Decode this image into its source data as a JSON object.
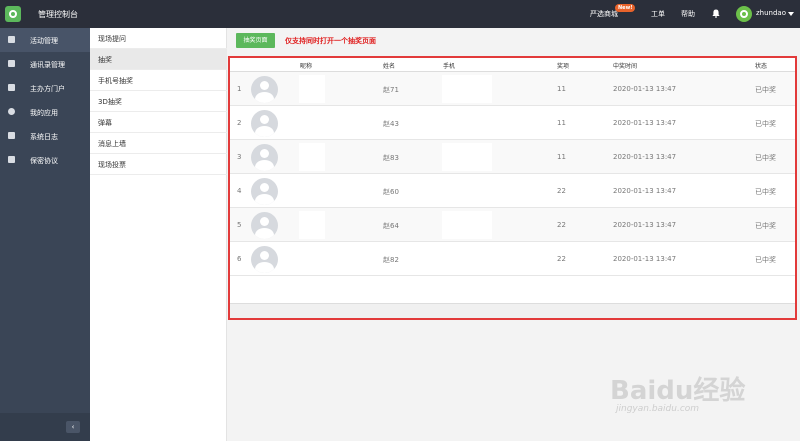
{
  "header": {
    "brand_title": "管理控制台",
    "nav_shop": "严选商城",
    "badge_new": "New!",
    "nav_ticket": "工单",
    "nav_help": "帮助",
    "username": "zhundao"
  },
  "sidebar": {
    "items": [
      {
        "label": "活动管理",
        "icon": "home-icon"
      },
      {
        "label": "通讯录管理",
        "icon": "contacts-icon"
      },
      {
        "label": "主办方门户",
        "icon": "portal-icon"
      },
      {
        "label": "我的应用",
        "icon": "app-icon"
      },
      {
        "label": "系统日志",
        "icon": "log-icon"
      },
      {
        "label": "保密协议",
        "icon": "document-icon"
      }
    ],
    "collapse_label": "‹"
  },
  "submenu": {
    "items": [
      {
        "label": "现场提问"
      },
      {
        "label": "抽奖"
      },
      {
        "label": "手机号抽奖"
      },
      {
        "label": "3D抽奖"
      },
      {
        "label": "弹幕"
      },
      {
        "label": "消息上墙"
      },
      {
        "label": "现场投票"
      }
    ]
  },
  "main": {
    "lottery_button": "抽奖页面",
    "tip": "仅支持同时打开一个抽奖页面",
    "table": {
      "headers": [
        "昵称",
        "姓名",
        "手机",
        "奖项",
        "中奖时间",
        "状态"
      ],
      "rows": [
        {
          "index": "1",
          "name": "赵71",
          "prize": "11",
          "time": "2020-01-13 13:47",
          "status": "已中奖"
        },
        {
          "index": "2",
          "name": "赵43",
          "prize": "11",
          "time": "2020-01-13 13:47",
          "status": "已中奖"
        },
        {
          "index": "3",
          "name": "赵83",
          "prize": "11",
          "time": "2020-01-13 13:47",
          "status": "已中奖"
        },
        {
          "index": "4",
          "name": "赵60",
          "prize": "22",
          "time": "2020-01-13 13:47",
          "status": "已中奖"
        },
        {
          "index": "5",
          "name": "赵64",
          "prize": "22",
          "time": "2020-01-13 13:47",
          "status": "已中奖"
        },
        {
          "index": "6",
          "name": "赵82",
          "prize": "22",
          "time": "2020-01-13 13:47",
          "status": "已中奖"
        }
      ]
    }
  },
  "watermark": {
    "logo": "Baidu经验",
    "url": "jingyan.baidu.com"
  },
  "colors": {
    "topbar": "#2b2f3a",
    "sidebar": "#3a4556",
    "accent_green": "#5cb85c",
    "highlight_red": "#e23a3a"
  }
}
